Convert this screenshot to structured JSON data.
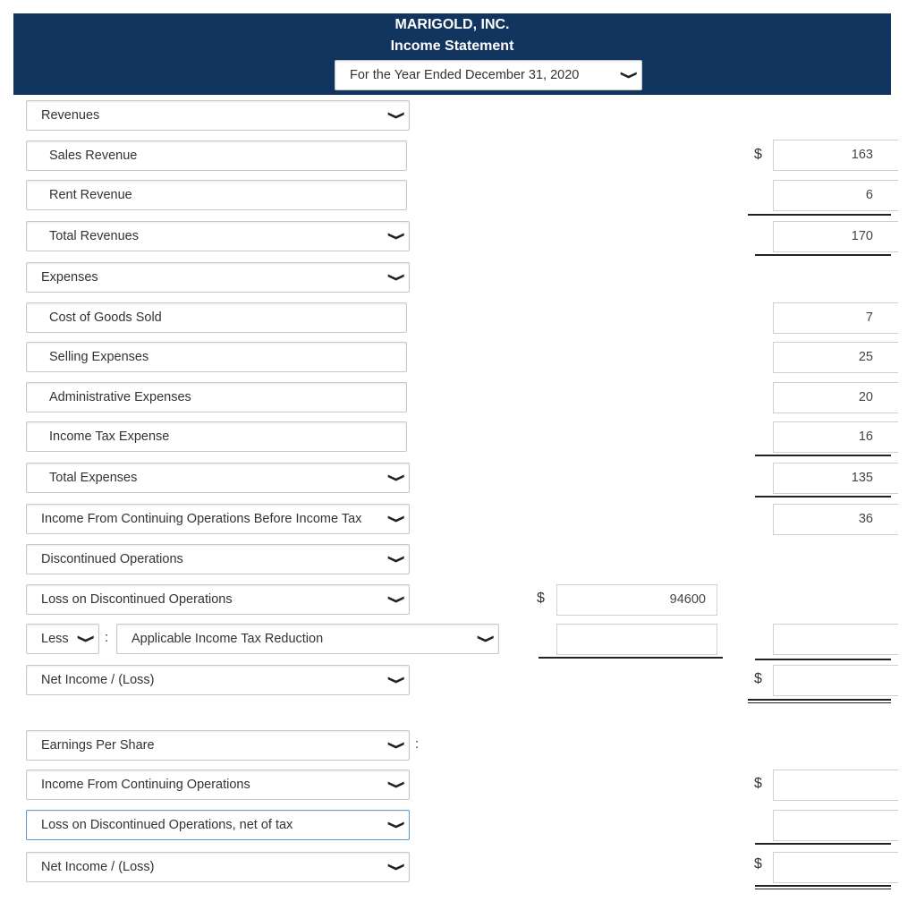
{
  "header": {
    "company": "MARIGOLD, INC.",
    "statement": "Income Statement",
    "period": "For the Year Ended December 31, 2020"
  },
  "rows": {
    "revenues": "Revenues",
    "sales_revenue": "Sales Revenue",
    "sales_revenue_amt": "163",
    "rent_revenue": "Rent Revenue",
    "rent_revenue_amt": "6",
    "total_revenues": "Total Revenues",
    "total_revenues_amt": "170",
    "expenses": "Expenses",
    "cogs": "Cost of Goods Sold",
    "cogs_amt": "7",
    "selling": "Selling Expenses",
    "selling_amt": "25",
    "admin": "Administrative Expenses",
    "admin_amt": "20",
    "income_tax": "Income Tax Expense",
    "income_tax_amt": "16",
    "total_expenses": "Total Expenses",
    "total_expenses_amt": "135",
    "income_before_tax": "Income From Continuing Operations Before Income Tax",
    "income_before_tax_amt": "36",
    "discontinued": "Discontinued Operations",
    "loss_disc": "Loss on Discontinued Operations",
    "loss_disc_amt": "94600",
    "less": "Less",
    "tax_reduction": "Applicable Income Tax Reduction",
    "net_income": "Net Income / (Loss)",
    "eps": "Earnings Per Share",
    "eps_cont": "Income From Continuing Operations",
    "eps_loss_disc": "Loss on Discontinued Operations, net of tax",
    "eps_net": "Net Income / (Loss)"
  },
  "symbols": {
    "dollar": "$",
    "colon": ":",
    "chevron": "❯"
  }
}
